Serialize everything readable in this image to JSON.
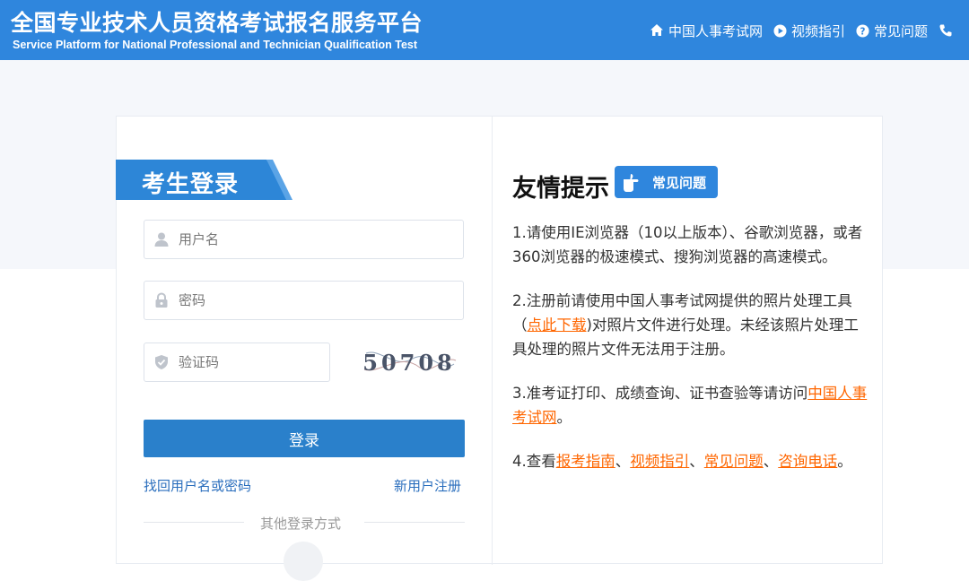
{
  "header": {
    "title": "全国专业技术人员资格考试报名服务平台",
    "subtitle": "Service Platform for National Professional and Technician Qualification Test",
    "nav": [
      {
        "label": "中国人事考试网",
        "icon": "home-icon"
      },
      {
        "label": "视频指引",
        "icon": "play-icon"
      },
      {
        "label": "常见问题",
        "icon": "question-icon"
      }
    ],
    "phone_icon": "phone-icon"
  },
  "login": {
    "title": "考生登录",
    "username_placeholder": "用户名",
    "password_placeholder": "密码",
    "captcha_placeholder": "验证码",
    "captcha_text": "50708",
    "submit_label": "登录",
    "forgot_link": "找回用户名或密码",
    "register_link": "新用户注册",
    "other_methods": "其他登录方式"
  },
  "tips": {
    "title": "友情提示",
    "faq_badge": "常见问题",
    "t1": "1.请使用IE浏览器（10以上版本）、谷歌浏览器，或者360浏览器的极速模式、搜狗浏览器的高速模式。",
    "t2_prefix": "2.注册前请使用中国人事考试网提供的照片处理工具（",
    "t2_link": "点此下载",
    "t2_suffix": ")对照片文件进行处理。未经该照片处理工具处理的照片文件无法用于注册。",
    "t3_prefix": "3.准考证打印、成绩查询、证书查验等请访问",
    "t3_link": "中国人事考试网",
    "t3_suffix": "。",
    "t4_prefix": "4.查看",
    "t4_link1": "报考指南",
    "t4_sep1": "、",
    "t4_link2": "视频指引",
    "t4_sep2": "、",
    "t4_link3": "常见问题",
    "t4_sep3": "、",
    "t4_link4": "咨询电话",
    "t4_suffix": "。"
  },
  "colors": {
    "header_bg": "#2f86dd",
    "primary_button": "#2a80cb",
    "link": "#2a6ebd",
    "highlight_link": "#ff6600"
  }
}
